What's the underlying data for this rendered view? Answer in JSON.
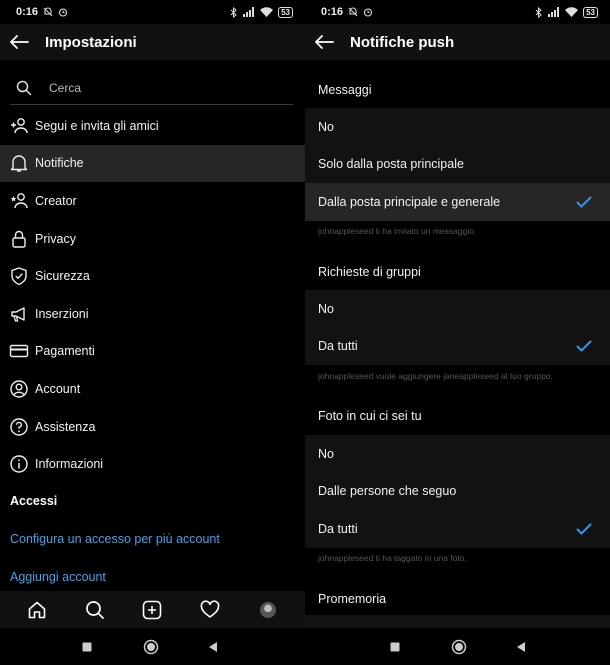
{
  "colors": {
    "accent": "#4a9fea",
    "check": "#3797f0",
    "background": "#000000",
    "selected": "#262626"
  },
  "status_left": {
    "time": "0:16",
    "battery": "53"
  },
  "status_right": {
    "time": "0:16",
    "battery": "53"
  },
  "left": {
    "title": "Impostazioni",
    "search_placeholder": "Cerca",
    "menu": [
      {
        "label": "Segui e invita gli amici",
        "icon": "add-person-icon"
      },
      {
        "label": "Notifiche",
        "icon": "bell-icon"
      },
      {
        "label": "Creator",
        "icon": "creator-icon"
      },
      {
        "label": "Privacy",
        "icon": "lock-icon"
      },
      {
        "label": "Sicurezza",
        "icon": "shield-icon"
      },
      {
        "label": "Inserzioni",
        "icon": "megaphone-icon"
      },
      {
        "label": "Pagamenti",
        "icon": "card-icon"
      },
      {
        "label": "Account",
        "icon": "account-icon"
      },
      {
        "label": "Assistenza",
        "icon": "help-icon"
      },
      {
        "label": "Informazioni",
        "icon": "info-icon"
      }
    ],
    "section_accessi": "Accessi",
    "link_multi": "Configura un accesso per più account",
    "link_add": "Aggiungi account"
  },
  "right": {
    "title": "Notifiche push",
    "groups": [
      {
        "title": "Messaggi",
        "options": [
          "No",
          "Solo dalla posta principale",
          "Dalla posta principale e generale"
        ],
        "selected_index": 2,
        "hint": "johnappleseed ti ha inviato un messaggio."
      },
      {
        "title": "Richieste di gruppi",
        "options": [
          "No",
          "Da tutti"
        ],
        "selected_index": 1,
        "hint": "johnappleseed vuole aggiungere janeappleseed al tuo gruppo."
      },
      {
        "title": "Foto in cui ci sei tu",
        "options": [
          "No",
          "Dalle persone che seguo",
          "Da tutti"
        ],
        "selected_index": 2,
        "hint": "johnappleseed ti ha taggato in una foto."
      }
    ],
    "next_group_title": "Promemoria"
  }
}
